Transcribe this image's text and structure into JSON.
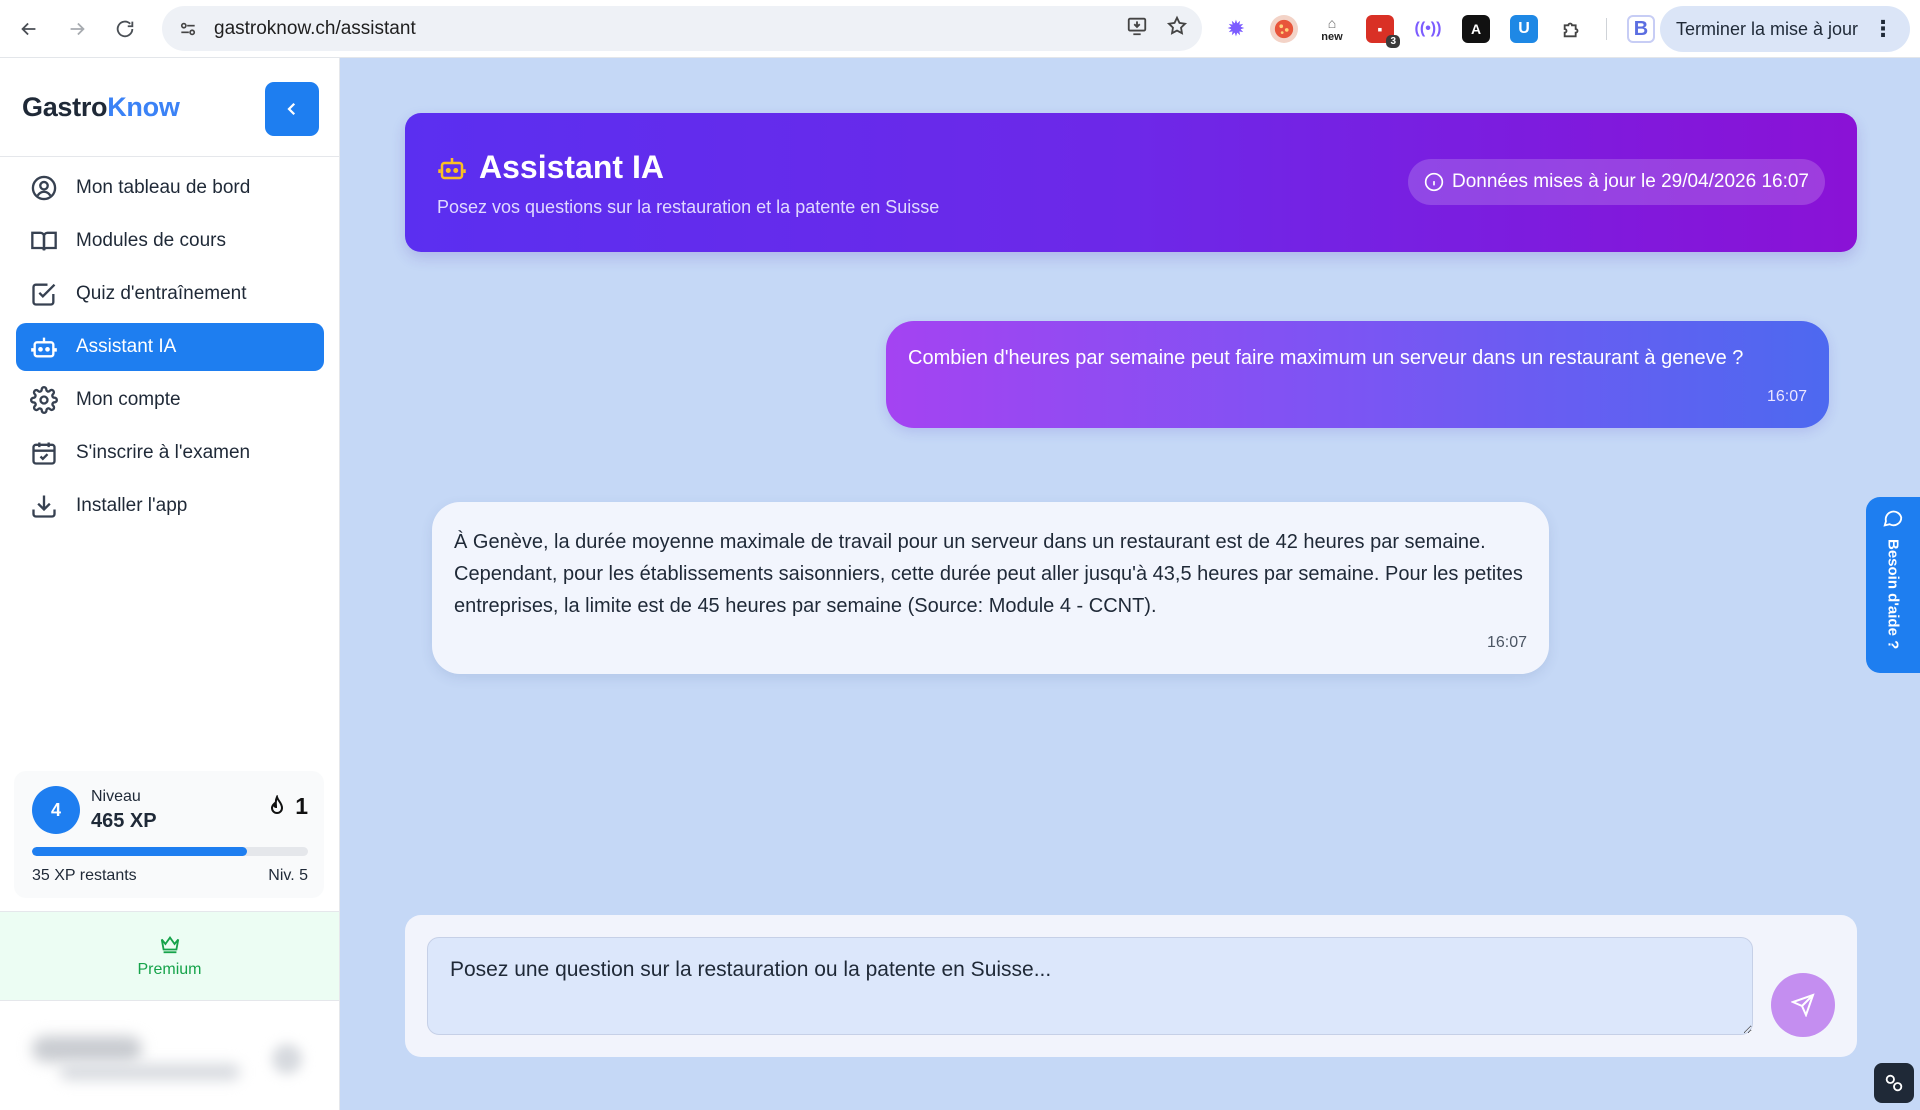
{
  "browser": {
    "url": "gastroknow.ch/assistant",
    "update_button": "Terminer la mise à jour",
    "extensions": [
      {
        "icon": "gear-purple-icon",
        "color": "#7c5cff"
      },
      {
        "icon": "pizza-icon",
        "color": "#e8553b"
      },
      {
        "icon": "new-extension-icon",
        "label": "new",
        "color": "#ffffff"
      },
      {
        "icon": "red-extension-icon",
        "badge": "3",
        "color": "#d93025"
      },
      {
        "icon": "broadcast-icon",
        "color": "#7c5cff"
      },
      {
        "icon": "black-a-icon",
        "color": "#111111"
      },
      {
        "icon": "u-shield-icon",
        "color": "#1e88e5"
      },
      {
        "icon": "puzzle-icon",
        "color": "#444444"
      },
      {
        "icon": "b-logo-icon",
        "color": "#5b6ee1"
      }
    ]
  },
  "sidebar": {
    "brand_part1": "Gastro",
    "brand_part2": "Know",
    "items": [
      {
        "label": "Mon tableau de bord",
        "icon": "user-circle-icon"
      },
      {
        "label": "Modules de cours",
        "icon": "book-open-icon"
      },
      {
        "label": "Quiz d'entraînement",
        "icon": "checkbox-icon"
      },
      {
        "label": "Assistant IA",
        "icon": "robot-icon",
        "active": true
      },
      {
        "label": "Mon compte",
        "icon": "gear-icon"
      },
      {
        "label": "S'inscrire à l'examen",
        "icon": "calendar-check-icon"
      },
      {
        "label": "Installer l'app",
        "icon": "download-icon"
      }
    ],
    "level": {
      "number": "4",
      "label": "Niveau",
      "xp": "465 XP",
      "streak": "1",
      "progress": 0.78,
      "remaining": "35 XP restants",
      "next": "Niv. 5"
    },
    "premium_label": "Premium"
  },
  "header": {
    "title": "Assistant IA",
    "subtitle": "Posez vos questions sur la restauration et la patente en Suisse",
    "update_info": "Données mises à jour le 29/04/2026 16:07"
  },
  "chat": {
    "messages": [
      {
        "role": "user",
        "text": "Combien d'heures par semaine peut faire maximum un serveur dans un restaurant à geneve ?",
        "time": "16:07"
      },
      {
        "role": "assistant",
        "text": "À Genève, la durée moyenne maximale de travail pour un serveur dans un restaurant est de 42 heures par semaine. Cependant, pour les établissements saisonniers, cette durée peut aller jusqu'à 43,5 heures par semaine. Pour les petites entreprises, la limite est de 45 heures par semaine (Source: Module 4 - CCNT).",
        "time": "16:07"
      }
    ]
  },
  "help_tab": "Besoin d'aide ?",
  "composer": {
    "placeholder": "Posez une question sur la restauration ou la patente en Suisse..."
  },
  "colors": {
    "primary": "#1e7ef0",
    "header_gradient_start": "#5b2ff0",
    "header_gradient_end": "#8a12d6",
    "background": "#c5d8f6",
    "premium_green": "#16a34a"
  }
}
